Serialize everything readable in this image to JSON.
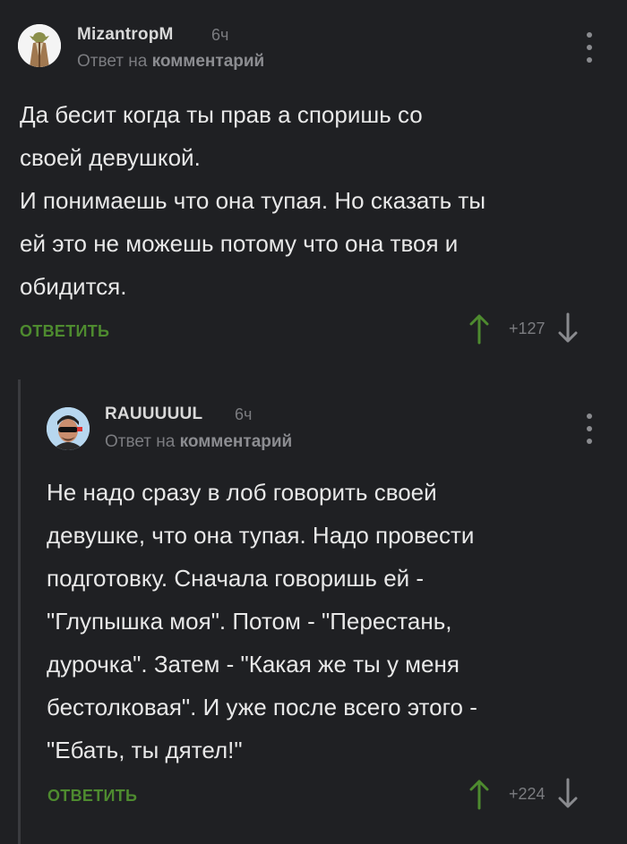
{
  "comments": [
    {
      "author": "MizantropM",
      "time": "6ч",
      "reply_prefix": "Ответ на",
      "reply_target": "комментарий",
      "text": "Да бесит когда ты прав а споришь со\nсвоей девушкой.\nИ понимаешь что она тупая. Но сказать ты\nей это не можешь потому что она твоя и\nобидится.",
      "reply_label": "ОТВЕТИТЬ",
      "score": "+127"
    },
    {
      "author": "RAUUUUUL",
      "time": "6ч",
      "reply_prefix": "Ответ на",
      "reply_target": "комментарий",
      "text": "Не надо сразу в лоб говорить своей\nдевушке, что она тупая. Надо провести\nподготовку. Сначала говоришь ей -\n\"Глупышка моя\". Потом - \"Перестань,\nдурочка\". Затем - \"Какая же ты у меня\nбестолковая\". И уже после всего этого -\n\"Ебать, ты дятел!\"",
      "reply_label": "ОТВЕТИТЬ",
      "score": "+224"
    }
  ],
  "icons": {
    "upvote": "arrow-up-icon",
    "downvote": "arrow-down-icon",
    "menu": "more-vertical-icon"
  },
  "colors": {
    "background": "#1f2023",
    "accent_green": "#4e8b2f",
    "muted": "#7b7c80"
  }
}
